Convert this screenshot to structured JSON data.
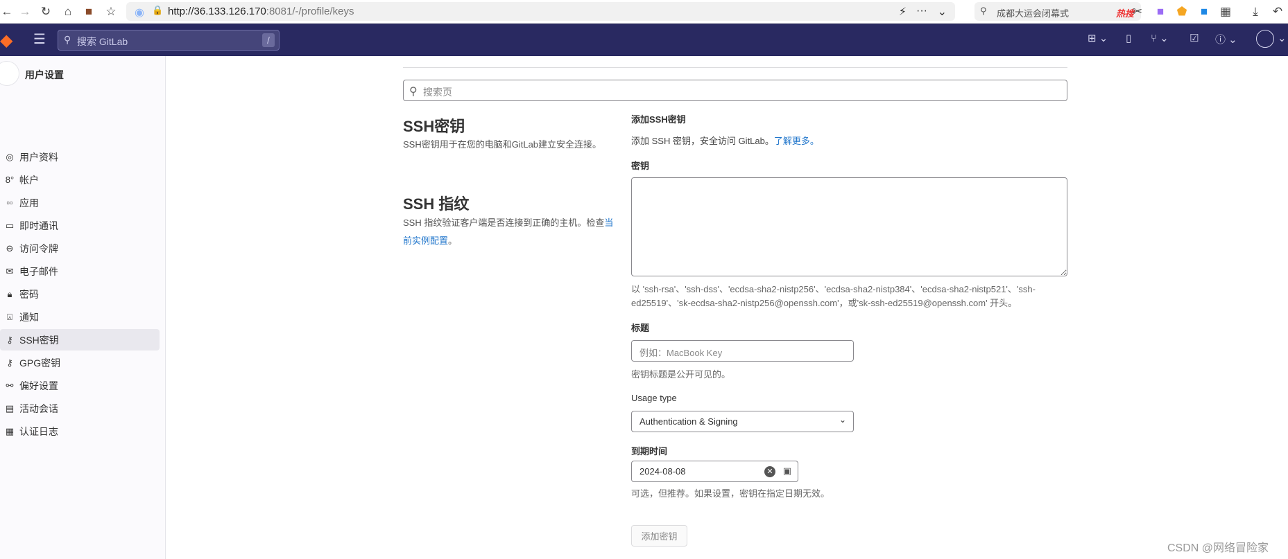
{
  "browser": {
    "url_host": "http://36.133.126.170",
    "url_rest": ":8081/-/profile/keys",
    "hot_search": "成都大运会闭幕式",
    "hot_label": "热搜"
  },
  "navbar": {
    "search_placeholder": "搜索 GitLab",
    "search_shortcut": "/"
  },
  "sidebar": {
    "title": "用户设置",
    "items": [
      {
        "label": "用户资料",
        "icon": "user-icon"
      },
      {
        "label": "帐户",
        "icon": "account-icon"
      },
      {
        "label": "应用",
        "icon": "applications-icon"
      },
      {
        "label": "即时通讯",
        "icon": "chat-icon"
      },
      {
        "label": "访问令牌",
        "icon": "token-icon"
      },
      {
        "label": "电子邮件",
        "icon": "mail-icon"
      },
      {
        "label": "密码",
        "icon": "lock-icon"
      },
      {
        "label": "通知",
        "icon": "bell-icon"
      },
      {
        "label": "SSH密钥",
        "icon": "key-icon",
        "active": true
      },
      {
        "label": "GPG密钥",
        "icon": "key-icon"
      },
      {
        "label": "偏好设置",
        "icon": "preferences-icon"
      },
      {
        "label": "活动会话",
        "icon": "monitor-icon"
      },
      {
        "label": "认证日志",
        "icon": "log-icon"
      }
    ]
  },
  "main": {
    "page_search_placeholder": "搜索页",
    "ssh_keys": {
      "title": "SSH密钥",
      "description": "SSH密钥用于在您的电脑和GitLab建立安全连接。"
    },
    "fingerprint": {
      "title": "SSH 指纹",
      "description": "SSH 指纹验证客户端是否连接到正确的主机。检查",
      "link": "当前实例配置",
      "suffix": "。"
    },
    "form": {
      "title": "添加SSH密钥",
      "intro": "添加 SSH 密钥，安全访问 GitLab。",
      "intro_link": "了解更多。",
      "key_label": "密钥",
      "key_value": "",
      "key_hint": "以 'ssh-rsa'、'ssh-dss'、'ecdsa-sha2-nistp256'、'ecdsa-sha2-nistp384'、'ecdsa-sha2-nistp521'、'ssh-ed25519'、'sk-ecdsa-sha2-nistp256@openssh.com'，或'sk-ssh-ed25519@openssh.com' 开头。",
      "title_label": "标题",
      "title_placeholder": "例如：MacBook Key",
      "title_help": "密钥标题是公开可见的。",
      "usage_label": "Usage type",
      "usage_value": "Authentication & Signing",
      "expiry_label": "到期时间",
      "expiry_value": "2024-08-08",
      "expiry_help": "可选，但推荐。如果设置，密钥在指定日期无效。",
      "submit": "添加密钥"
    }
  },
  "watermark": "CSDN @网络冒险家",
  "colors": {
    "navbar": "#292961",
    "link": "#1f75cb"
  }
}
